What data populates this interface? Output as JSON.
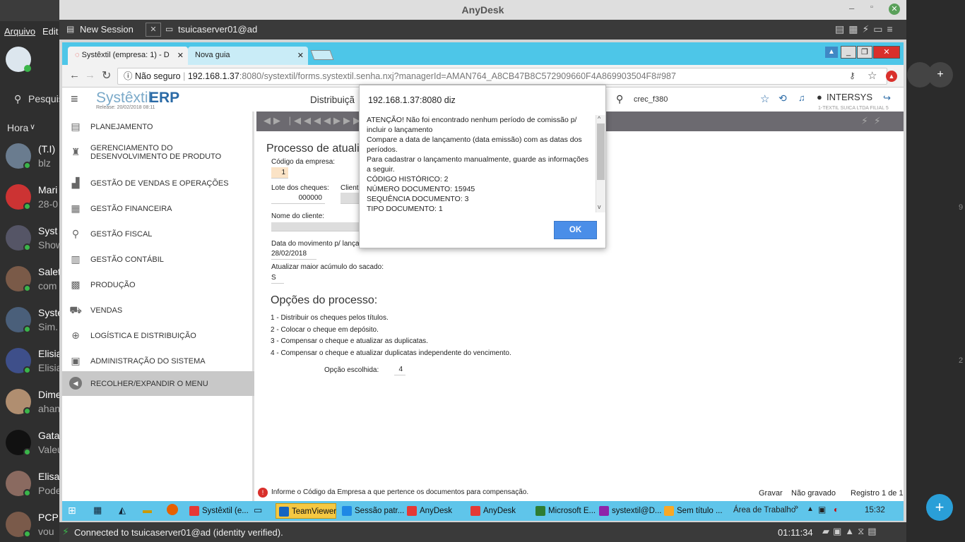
{
  "outer_menu": {
    "file": "Arquivo",
    "edit": "Edit"
  },
  "left_app": {
    "search_placeholder": "Pesquis",
    "filter_label": "Hora",
    "chats": [
      {
        "name": "(T.I)",
        "preview": "blz",
        "avatar_color": "#6a7c8f"
      },
      {
        "name": "Mari",
        "preview": "28-0",
        "avatar_color": "#c33"
      },
      {
        "name": "Syst",
        "preview": "Show",
        "avatar_color": "#556"
      },
      {
        "name": "Salet",
        "preview": "com",
        "avatar_color": "#7a5a48"
      },
      {
        "name": "Syste",
        "preview": "Sim.",
        "avatar_color": "#4a5f7a"
      },
      {
        "name": "Elisia",
        "preview": "Elisia",
        "avatar_color": "#3e4f8a"
      },
      {
        "name": "Dime",
        "preview": "ahan",
        "avatar_color": "#b08e70"
      },
      {
        "name": "Gata",
        "preview": "Valeu",
        "avatar_color": "#111"
      },
      {
        "name": "Elisa",
        "preview": "Pode",
        "avatar_color": "#8a6a60"
      },
      {
        "name": "PCP",
        "preview": "vou",
        "avatar_color": "#7a5a4a"
      }
    ]
  },
  "anydesk": {
    "title": "AnyDesk",
    "new_session": "New Session",
    "remote_tab": "tsuicaserver01@ad",
    "status": "Connected to tsuicaserver01@ad (identity verified).",
    "session_time": "01:11:34"
  },
  "browser": {
    "tab1": "Systêxtil (empresa: 1) - D",
    "tab2": "Nova guia",
    "not_secure": "Não seguro",
    "url_host": "192.168.1.37",
    "url_rest": ":8080/systextil/forms.systextil.senha.nxj?managerId=AMAN764_A8CB47B8C572909660F4A869903504F8#987"
  },
  "app": {
    "logo_a": "Systêxtil",
    "logo_b": "ERP",
    "release": "Release: 20/02/2018 08:11",
    "module_title": "Distribuiçã",
    "search_value": "crec_f380",
    "user": "INTERSYS",
    "company": "1-TEXTIL SUICA LTDA FILIAL 5",
    "menu": [
      {
        "label": "PLANEJAMENTO",
        "icon": "clipboard-icon"
      },
      {
        "label": "GERENCIAMENTO DO DESENVOLVIMENTO DE PRODUTO",
        "icon": "shirt-icon"
      },
      {
        "label": "GESTÃO DE VENDAS E OPERAÇÕES",
        "icon": "chart-icon"
      },
      {
        "label": "GESTÃO FINANCEIRA",
        "icon": "calculator-icon"
      },
      {
        "label": "GESTÃO FISCAL",
        "icon": "magnifier-doc-icon"
      },
      {
        "label": "GESTÃO CONTÁBIL",
        "icon": "ledger-icon"
      },
      {
        "label": "PRODUÇÃO",
        "icon": "factory-icon"
      },
      {
        "label": "VENDAS",
        "icon": "cart-icon"
      },
      {
        "label": "LOGÍSTICA E DISTRIBUIÇÃO",
        "icon": "globe-icon"
      },
      {
        "label": "ADMINISTRAÇÃO DO SISTEMA",
        "icon": "admin-icon"
      },
      {
        "label": "RECOLHER/EXPANDIR O MENU",
        "icon": "collapse-icon"
      }
    ]
  },
  "form": {
    "title": "Processo de atualiz",
    "empresa_label": "Código da empresa:",
    "empresa_value": "1",
    "lote_label": "Lote dos cheques:",
    "lote_value": "000000",
    "cliente_label": "Cliente",
    "nome_label": "Nome do cliente:",
    "data_label": "Data do movimento p/ lançam",
    "data_value": "28/02/2018",
    "acumulo_label": "Atualizar maior acúmulo do sacado:",
    "acumulo_value": "S",
    "opcoes_title": "Opções do processo:",
    "opcoes": [
      "1 - Distribuir os cheques pelos títulos.",
      "2 - Colocar o cheque em depósito.",
      "3 - Compensar o cheque e atualizar as duplicatas.",
      "4 - Compensar o cheque e atualizar duplicatas independente do vencimento."
    ],
    "opcao_label": "Opção escolhida:",
    "opcao_value": "4",
    "hint": "Informe o Código da Empresa a que pertence os documentos para compensação.",
    "status_gravar": "Gravar",
    "status_nao_gravado": "Não gravado",
    "status_registro": "Registro 1 de 1"
  },
  "dialog": {
    "title": "192.168.1.37:8080 diz",
    "lines": [
      "ATENÇÃO! Não foi encontrado nenhum período de comissão p/",
      "incluir o lançamento",
      "Compare a data de lançamento (data emissão) com as datas dos",
      "períodos.",
      "Para cadastrar o lançamento manualmente, guarde as informações",
      "a seguir.",
      "CÓDIGO HISTÓRICO: 2",
      "NÚMERO DOCUMENTO: 15945",
      "SEQUÊNCIA DOCUMENTO: 3",
      "TIPO DOCUMENTO: 1"
    ],
    "ok": "OK"
  },
  "taskbar": {
    "items": [
      {
        "label": "Systêxtil (e...",
        "color": "#e53935"
      },
      {
        "label": "TeamViewer",
        "color": "#1565c0"
      },
      {
        "label": "Sessão patr...",
        "color": "#1e88e5"
      },
      {
        "label": "AnyDesk",
        "color": "#e53935"
      },
      {
        "label": "AnyDesk",
        "color": "#e53935"
      },
      {
        "label": "Microsoft E...",
        "color": "#2e7d32"
      },
      {
        "label": "systextil@D...",
        "color": "#8e24aa"
      },
      {
        "label": "Sem título ...",
        "color": "#f9a825"
      }
    ],
    "desktop": "Área de Trabalho",
    "clock": "15:32"
  },
  "right_app": {
    "side_nums": [
      "9",
      "2"
    ]
  }
}
